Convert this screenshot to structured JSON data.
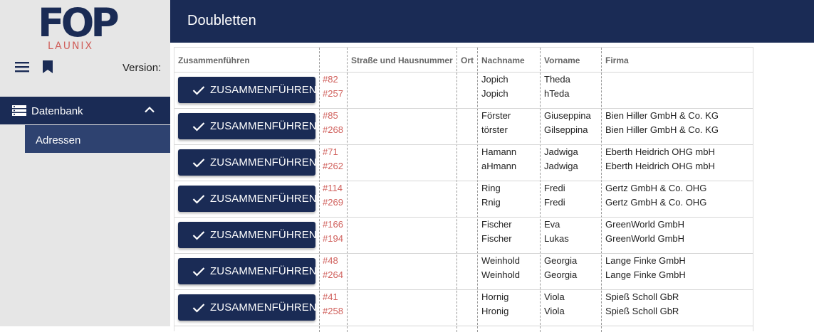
{
  "sidebar": {
    "logo_main": "FOP",
    "logo_sub": "LAUNIX",
    "version_label": "Version:",
    "nav": {
      "database_label": "Datenbank",
      "addresses_label": "Adressen"
    }
  },
  "header": {
    "title": "Doubletten"
  },
  "table": {
    "columns": {
      "merge": "Zusammenführen",
      "street": "Straße und Hausnummer",
      "city": "Ort",
      "lastname": "Nachname",
      "firstname": "Vorname",
      "company": "Firma"
    },
    "merge_label": "ZUSAMMENFÜHREN",
    "rows": [
      {
        "id1": "#82",
        "id2": "#257",
        "street1": "",
        "street2": "",
        "city1": "",
        "city2": "",
        "last1": "Jopich",
        "last2": "Jopich",
        "first1": "Theda",
        "first2": "hTeda",
        "company1": "",
        "company2": ""
      },
      {
        "id1": "#85",
        "id2": "#268",
        "street1": "",
        "street2": "",
        "city1": "",
        "city2": "",
        "last1": "Förster",
        "last2": "törster",
        "first1": "Giuseppina",
        "first2": "Gilseppina",
        "company1": "Bien Hiller GmbH & Co. KG",
        "company2": "Bien Hiller GmbH & Co. KG"
      },
      {
        "id1": "#71",
        "id2": "#262",
        "street1": "",
        "street2": "",
        "city1": "",
        "city2": "",
        "last1": "Hamann",
        "last2": "aHmann",
        "first1": "Jadwiga",
        "first2": "Jadwiga",
        "company1": "Eberth Heidrich OHG mbH",
        "company2": "Eberth Heidrich OHG mbH"
      },
      {
        "id1": "#114",
        "id2": "#269",
        "street1": "",
        "street2": "",
        "city1": "",
        "city2": "",
        "last1": "Ring",
        "last2": "Rnig",
        "first1": "Fredi",
        "first2": "Fredi",
        "company1": "Gertz GmbH & Co. OHG",
        "company2": "Gertz GmbH & Co. OHG"
      },
      {
        "id1": "#166",
        "id2": "#194",
        "street1": "",
        "street2": "",
        "city1": "",
        "city2": "",
        "last1": "Fischer",
        "last2": "Fischer",
        "first1": "Eva",
        "first2": "Lukas",
        "company1": "GreenWorld GmbH",
        "company2": "GreenWorld GmbH"
      },
      {
        "id1": "#48",
        "id2": "#264",
        "street1": "",
        "street2": "",
        "city1": "",
        "city2": "",
        "last1": "Weinhold",
        "last2": "Weinhold",
        "first1": "Georgia",
        "first2": "Georgia",
        "company1": "Lange Finke GmbH",
        "company2": "Lange Finke GmbH"
      },
      {
        "id1": "#41",
        "id2": "#258",
        "street1": "",
        "street2": "",
        "city1": "",
        "city2": "",
        "last1": "Hornig",
        "last2": "Hronig",
        "first1": "Viola",
        "first2": "Viola",
        "company1": "Spieß Scholl GbR",
        "company2": "Spieß Scholl GbR"
      }
    ]
  },
  "colors": {
    "primary": "#1a2b55",
    "nav_active": "#2e4270",
    "id_link": "#d0605c",
    "sidebar_bg": "#e6e6e6"
  },
  "icons": {
    "menu": "menu-icon",
    "bookmark": "bookmark-icon",
    "database": "database-icon",
    "collapse": "chevron-up-icon",
    "check": "check-icon"
  }
}
